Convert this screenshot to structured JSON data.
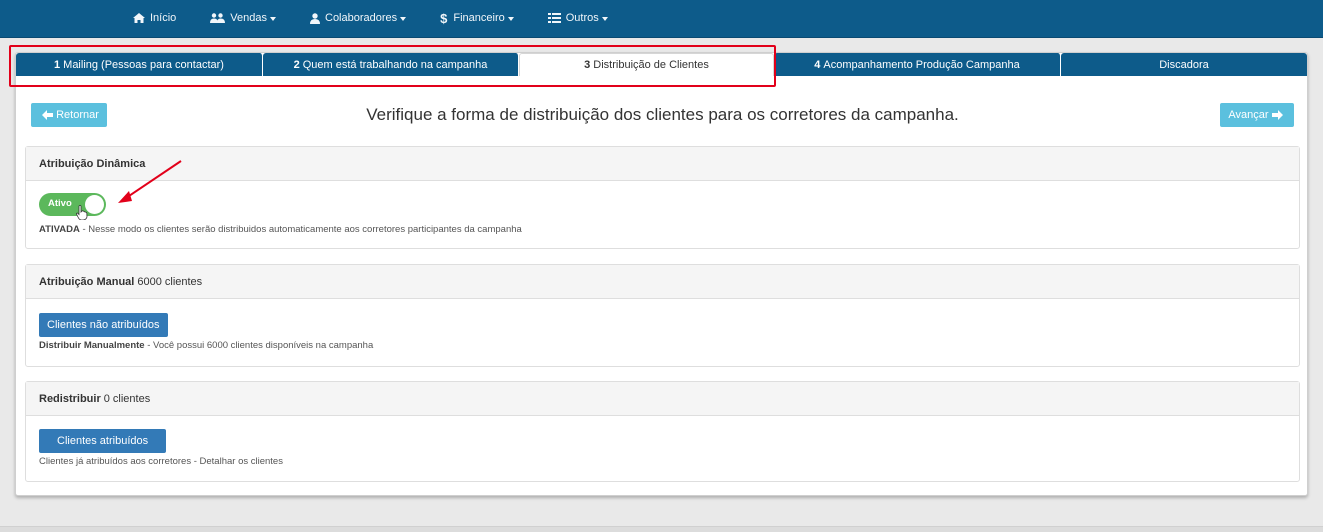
{
  "navbar": {
    "items": [
      {
        "label": "Início",
        "icon": "home-icon",
        "has_caret": false
      },
      {
        "label": "Vendas",
        "icon": "users-icon",
        "has_caret": true
      },
      {
        "label": "Colaboradores",
        "icon": "user-icon",
        "has_caret": true
      },
      {
        "label": "Financeiro",
        "icon": "dollar-icon",
        "has_caret": true
      },
      {
        "label": "Outros",
        "icon": "list-icon",
        "has_caret": true
      }
    ]
  },
  "tabs": [
    {
      "num": "1",
      "label": "Mailing (Pessoas para contactar)",
      "active": false
    },
    {
      "num": "2",
      "label": "Quem está trabalhando na campanha",
      "active": false
    },
    {
      "num": "3",
      "label": "Distribuição de Clientes",
      "active": true
    },
    {
      "num": "4",
      "label": "Acompanhamento Produção Campanha",
      "active": false
    },
    {
      "num": "",
      "label": "Discadora",
      "active": false
    }
  ],
  "header": {
    "back_label": "Retornar",
    "next_label": "Avançar",
    "title": "Verifique a forma de distribuição dos clientes para os corretores da campanha."
  },
  "dynamic": {
    "title": "Atribuição Dinâmica",
    "toggle_label": "Ativo",
    "toggle_on": true,
    "status": "ATIVADA",
    "description": " - Nesse modo os clientes serão distribuidos automaticamente aos corretores participantes da campanha"
  },
  "manual": {
    "title": "Atribuição Manual",
    "count_text": "6000 clientes",
    "button_label": "Clientes não atribuídos",
    "desc_bold": "Distribuir Manualmente",
    "description": " - Você possui 6000 clientes disponíveis na campanha"
  },
  "redistribute": {
    "title": "Redistribuir",
    "count_text": "0 clientes",
    "button_label": "Clientes atribuídos",
    "description": "Clientes já atribuídos aos corretores - Detalhar os clientes"
  },
  "colors": {
    "navbar": "#0d5b8a",
    "info_button": "#5bc0de",
    "primary_button": "#337ab7",
    "toggle_on": "#5cb85c",
    "annotation_red": "#e2001a"
  }
}
